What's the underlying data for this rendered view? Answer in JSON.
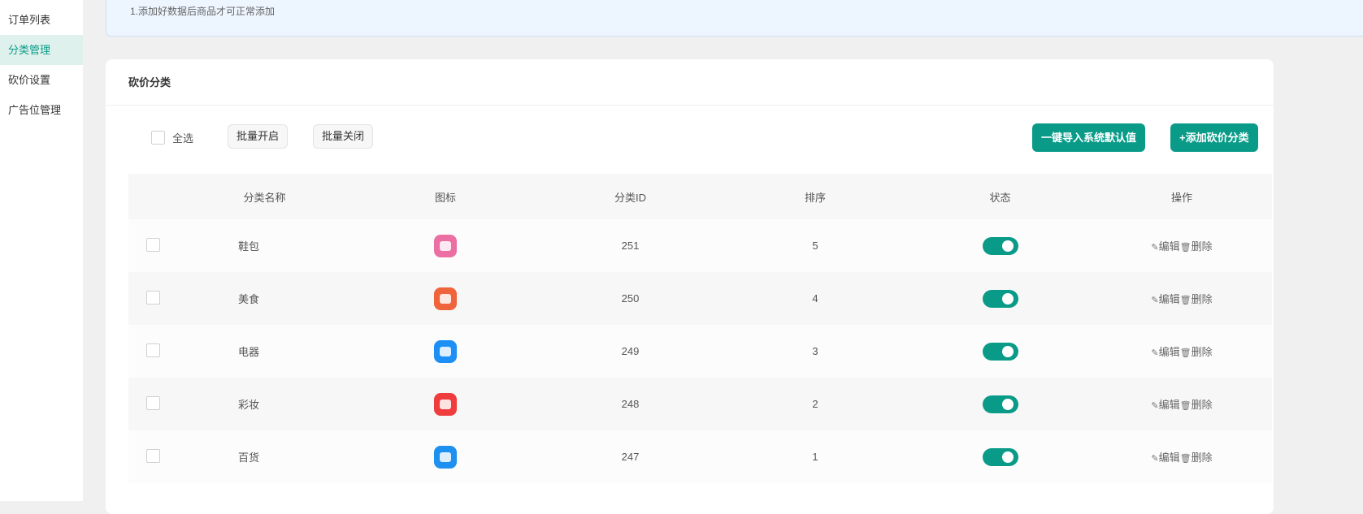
{
  "sidebar": {
    "items": [
      {
        "label": "订单列表"
      },
      {
        "label": "分类管理",
        "active": true
      },
      {
        "label": "砍价设置"
      },
      {
        "label": "广告位管理"
      }
    ]
  },
  "notice": {
    "text": "1.添加好数据后商品才可正常添加"
  },
  "card": {
    "title": "砍价分类"
  },
  "toolbar": {
    "select_all": "全选",
    "batch_on": "批量开启",
    "batch_off": "批量关闭",
    "import_default": "一键导入系统默认值",
    "add_category": "+添加砍价分类"
  },
  "table": {
    "headers": [
      "分类名称",
      "图标",
      "分类ID",
      "排序",
      "状态",
      "操作"
    ],
    "edit_label": "编辑",
    "delete_label": "删除",
    "rows": [
      {
        "name": "鞋包",
        "icon": "bag-icon",
        "icon_color": "#ec6fa4",
        "id": "251",
        "sort": "5",
        "status": true
      },
      {
        "name": "美食",
        "icon": "food-icon",
        "icon_color": "#f0643c",
        "id": "250",
        "sort": "4",
        "status": true
      },
      {
        "name": "电器",
        "icon": "fridge-icon",
        "icon_color": "#1e8ff5",
        "id": "249",
        "sort": "3",
        "status": true
      },
      {
        "name": "彩妆",
        "icon": "cosmetics-icon",
        "icon_color": "#ef3c3c",
        "id": "248",
        "sort": "2",
        "status": true
      },
      {
        "name": "百货",
        "icon": "basket-icon",
        "icon_color": "#1e90f0",
        "id": "247",
        "sort": "1",
        "status": true
      }
    ]
  },
  "colors": {
    "accent": "#0a9b88"
  }
}
